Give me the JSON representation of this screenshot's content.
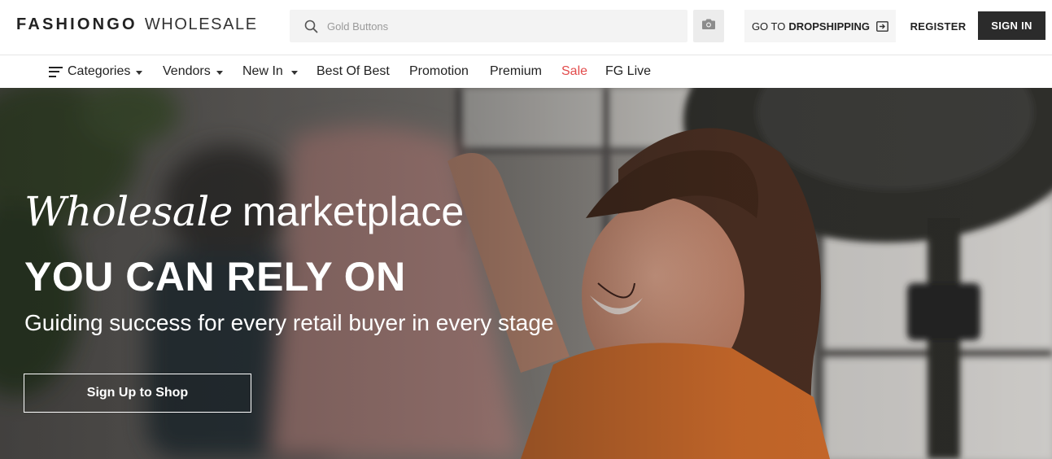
{
  "header": {
    "logo_brand": "FASHIONGO",
    "logo_sub": "WHOLESALE",
    "search": {
      "placeholder": "Gold Buttons",
      "value": ""
    },
    "dropshipping": {
      "prefix": "GO TO",
      "label": "DROPSHIPPING"
    },
    "register_label": "REGISTER",
    "signin_label": "SIGN IN",
    "icons": [
      "search-icon",
      "camera-icon",
      "external-link-icon"
    ]
  },
  "nav": {
    "items": [
      {
        "label": "Categories",
        "has_dropdown": true,
        "icon": "menu-icon"
      },
      {
        "label": "Vendors",
        "has_dropdown": true
      },
      {
        "label": "New In",
        "has_dropdown": true
      },
      {
        "label": "Best Of Best",
        "has_dropdown": false
      },
      {
        "label": "Promotion",
        "has_dropdown": false
      },
      {
        "label": "Premium",
        "has_dropdown": false
      },
      {
        "label": "Sale",
        "has_dropdown": false,
        "color": "#e24b4b"
      },
      {
        "label": "FG Live",
        "has_dropdown": false
      }
    ]
  },
  "hero": {
    "script_word": "Wholesale",
    "title_rest": "marketplace",
    "headline": "YOU CAN RELY ON",
    "subhead": "Guiding success for every retail buyer in every stage",
    "cta_label": "Sign Up to Shop"
  },
  "colors": {
    "signin_bg": "#2b2b2b",
    "sale_text": "#e24b4b",
    "search_bg": "#f3f3f3"
  }
}
